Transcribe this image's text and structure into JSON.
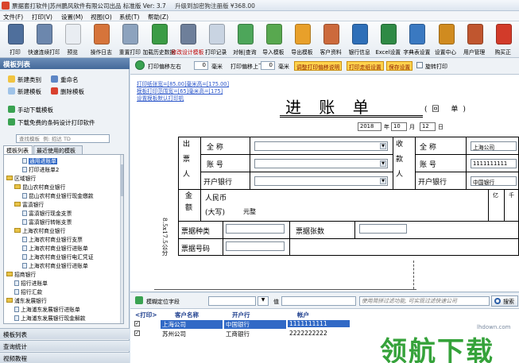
{
  "window": {
    "title": "票据套打软件|苏州鹏风软件有限公司出品  标准版   Ver: 3.7",
    "upgrade_text": "升级到加密狗注册版 ¥368.00"
  },
  "menu": [
    "文件(F)",
    "打印(V)",
    "设置(M)",
    "视图(O)",
    "系统(T)",
    "帮助(Z)"
  ],
  "toolbar": [
    {
      "label": "打印",
      "icon": "printer-icon",
      "color": "#4f6f9c"
    },
    {
      "label": "快速连续打印",
      "icon": "batch-print-icon",
      "color": "#6c87ad"
    },
    {
      "label": "预览",
      "icon": "magnifier-icon",
      "color": "#e9edf2"
    },
    {
      "label": "操作日志",
      "icon": "user-log-icon",
      "color": "#d6743a"
    },
    {
      "label": "重置打印",
      "icon": "reset-print-icon",
      "color": "#8da3be"
    },
    {
      "label": "加载历史数据",
      "icon": "load-history-icon",
      "color": "#3b9c45"
    },
    {
      "label": "修改设计模板",
      "icon": "edit-template-icon",
      "color": "#6e7f9a",
      "highlight": true
    },
    {
      "label": "打印记录",
      "icon": "print-record-icon",
      "color": "#c9d4e2"
    },
    {
      "label": "对帐|查询",
      "icon": "reconcile-icon",
      "color": "#4da65a"
    },
    {
      "label": "导入模板",
      "icon": "import-arrow-icon",
      "color": "#58a84f"
    },
    {
      "label": "导出模板",
      "icon": "export-arrow-icon",
      "color": "#e8a02a"
    },
    {
      "label": "客户资料",
      "icon": "customers-icon",
      "color": "#cc6a3c"
    },
    {
      "label": "银行信息",
      "icon": "bank-icon",
      "color": "#2e6fb8"
    },
    {
      "label": "Excel设置",
      "icon": "excel-icon",
      "color": "#2f8a45"
    },
    {
      "label": "字典表设置",
      "icon": "dictionary-icon",
      "color": "#3a79c1"
    },
    {
      "label": "设置中心",
      "icon": "tools-icon",
      "color": "#d08b1f"
    },
    {
      "label": "用户管理",
      "icon": "user-manage-icon",
      "color": "#c0562f"
    },
    {
      "label": "购买正",
      "icon": "buy-icon",
      "color": "#d23b2a"
    }
  ],
  "left_panel": {
    "header": "模板列表",
    "actions": [
      {
        "label": "新建类别",
        "icon": "new-category-icon"
      },
      {
        "label": "重命名",
        "icon": "rename-icon"
      },
      {
        "label": "新建模板",
        "icon": "new-template-icon"
      },
      {
        "label": "删除模板",
        "icon": "delete-template-icon"
      },
      {
        "label": "手动下载模板",
        "icon": "download-template-icon"
      },
      {
        "label": "下载免费的条码设计打印软件",
        "icon": "download-barcode-icon"
      }
    ],
    "search_placeholder": "查找模板  例: 招达 TD",
    "tabs": [
      "模板列表",
      "最近使用的模板"
    ],
    "tree": [
      {
        "level": 2,
        "type": "doc",
        "label": "通用进账单",
        "selected": true
      },
      {
        "level": 2,
        "type": "doc",
        "label": "打印进账单2"
      },
      {
        "level": 0,
        "type": "folder",
        "label": "区域银行"
      },
      {
        "level": 1,
        "type": "folder",
        "label": "昆山农村商业银行"
      },
      {
        "level": 2,
        "type": "doc",
        "label": "昆山农村商业银行现金缴款"
      },
      {
        "level": 1,
        "type": "folder",
        "label": "富滇银行"
      },
      {
        "level": 2,
        "type": "doc",
        "label": "富滇银行现金支票"
      },
      {
        "level": 2,
        "type": "doc",
        "label": "富滇银行转帐支票"
      },
      {
        "level": 1,
        "type": "folder",
        "label": "上海农村商业银行"
      },
      {
        "level": 2,
        "type": "doc",
        "label": "上海农村商业银行支票"
      },
      {
        "level": 2,
        "type": "doc",
        "label": "上海农村商业银行进账单"
      },
      {
        "level": 2,
        "type": "doc",
        "label": "上海农村商业银行电汇凭证"
      },
      {
        "level": 2,
        "type": "doc",
        "label": "上海农村商业银行进账单"
      },
      {
        "level": 0,
        "type": "folder",
        "label": "招商银行"
      },
      {
        "level": 1,
        "type": "doc",
        "label": "招行进账单"
      },
      {
        "level": 1,
        "type": "doc",
        "label": "招行汇款"
      },
      {
        "level": 0,
        "type": "folder",
        "label": "浦东发展银行"
      },
      {
        "level": 1,
        "type": "doc",
        "label": "上海浦东发展银行进账单"
      },
      {
        "level": 1,
        "type": "doc",
        "label": "上海浦东发展银行现金解款"
      }
    ],
    "bottom_tabs": [
      "模板列表",
      "查询统计",
      "视频教程"
    ]
  },
  "controls": {
    "offset_x_label": "打印偏移左右",
    "offset_x_value": "0",
    "offset_y_label": "打印偏移上下",
    "offset_y_value": "0",
    "unit": "毫米",
    "btn_adjust": "调整打印偏移说明",
    "btn_front": "打印走纸设置",
    "btn_save": "保存设置",
    "rotate_label": "旋转打印"
  },
  "canvas": {
    "hints": [
      "打印纸张宽=[85.00]毫米高=[175.00]",
      "模板打印范围宽=[65]毫米高=[175]",
      "设置模板默认打印机"
    ],
    "title": "进 账 单",
    "subtitle": "(回  单)",
    "date": {
      "year": "2018",
      "month": "10",
      "day": "12",
      "year_lbl": "年",
      "month_lbl": "月",
      "day_lbl": "日"
    },
    "payer_side": "出票人",
    "payee_side": "收款人",
    "row_full_name": "全  称",
    "row_account": "账  号",
    "row_bank": "开户银行",
    "payee_name_value": "上海公司",
    "payee_account_value": "1111111111",
    "payee_bank_value": "中国银行",
    "amount_side": "金额",
    "amount_rmb": "人民币",
    "amount_upper": "(大写)",
    "amount_value": "元整",
    "digit_headers": [
      "亿",
      "千"
    ],
    "bill_type": "票据种类",
    "bill_count": "票据张数",
    "bill_number": "票据号码",
    "side_note": "8.5x17.5公分"
  },
  "fieldbar": {
    "locate_label": "模糊定位字段",
    "value_label": "值",
    "search_placeholder": "使用简拼过滤功能, 可实现过滤快速公司",
    "search_button": "搜索"
  },
  "grid": {
    "headers": [
      "<打印>",
      "客户名称",
      "开户行",
      "帐户"
    ],
    "rows": [
      {
        "checked": true,
        "name": "上海公司",
        "bank": "中国银行",
        "account": "1111111111",
        "selected": true
      },
      {
        "checked": true,
        "name": "苏州公司",
        "bank": "工商银行",
        "account": "2222222222",
        "selected": false
      }
    ]
  },
  "watermark": {
    "site": "lhdown.com",
    "text": "领航下载"
  }
}
